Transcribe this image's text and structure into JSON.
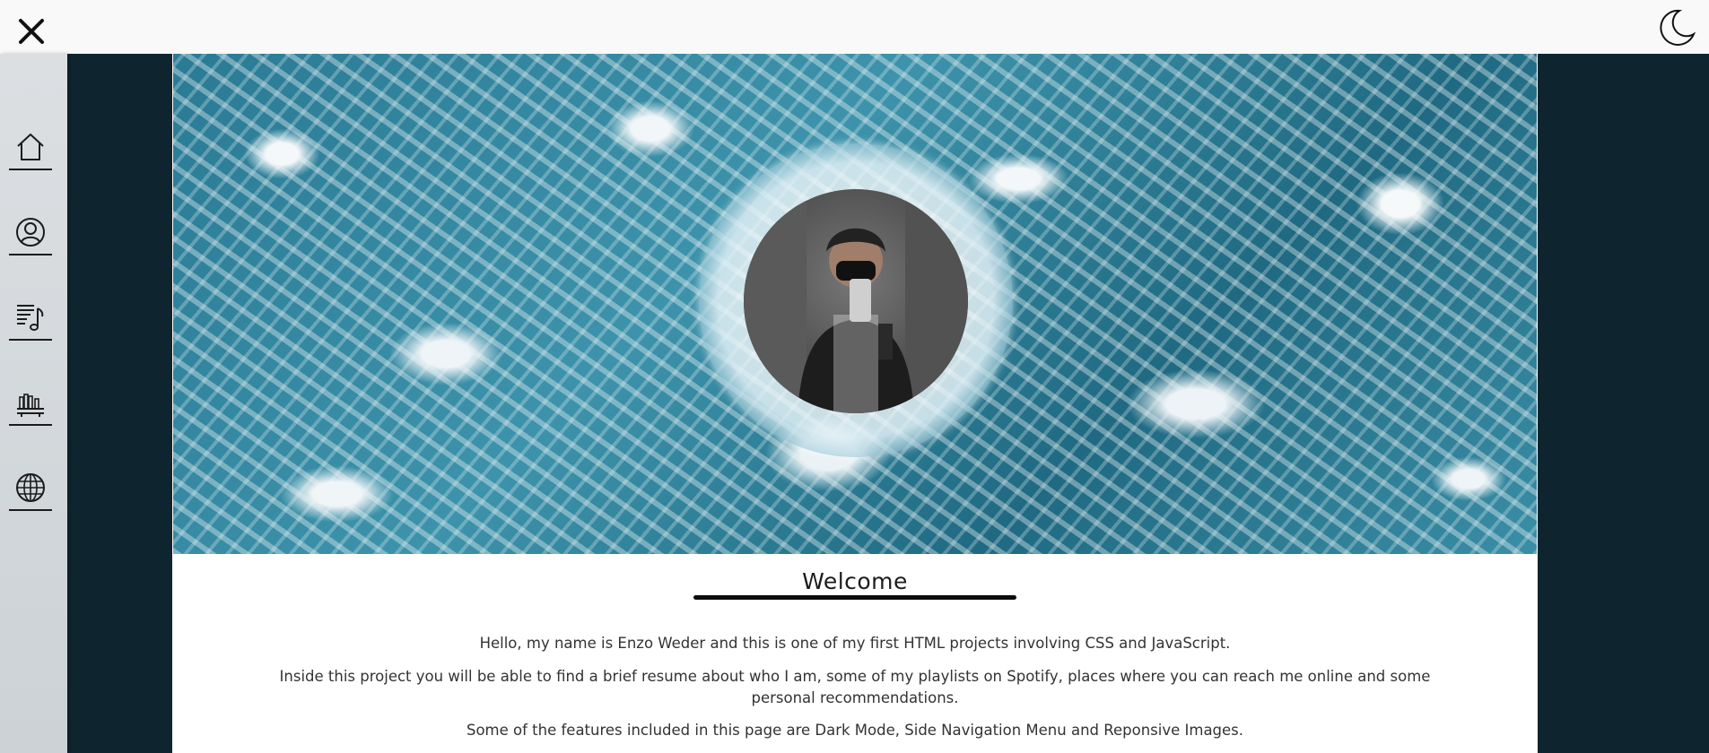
{
  "topbar": {
    "close_icon": "close-icon",
    "theme_icon": "moon-icon"
  },
  "sidebar": {
    "items": [
      {
        "name": "home",
        "icon": "home-icon"
      },
      {
        "name": "about",
        "icon": "user-icon"
      },
      {
        "name": "playlists",
        "icon": "music-list-icon"
      },
      {
        "name": "recommendations",
        "icon": "bookshelf-icon"
      },
      {
        "name": "social",
        "icon": "globe-icon"
      }
    ]
  },
  "hero": {
    "background": "ocean-waves-image",
    "avatar": "profile-photo"
  },
  "main": {
    "title": "Welcome",
    "paragraphs": [
      "Hello, my name is Enzo Weder and this is one of my first HTML projects involving CSS and JavaScript.",
      "Inside this project you will be able to find a brief resume about who I am, some of my playlists on Spotify, places where you can reach me online and some personal recommendations.",
      "Some of the features included in this page are Dark Mode, Side Navigation Menu and Reponsive Images."
    ]
  },
  "colors": {
    "page_bg": "#0e2530",
    "topbar_bg": "#f9f9f9",
    "sidebar_bg": "#d3d8dc",
    "content_bg": "#ffffff",
    "accent": "#0c0c0c"
  }
}
